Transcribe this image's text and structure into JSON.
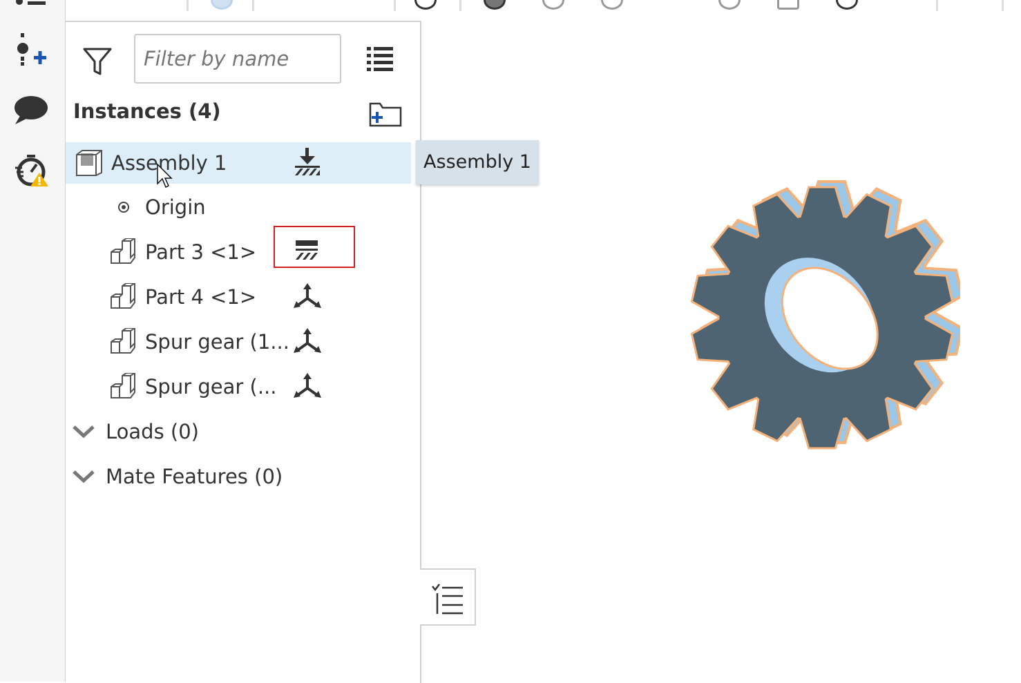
{
  "filter": {
    "placeholder": "Filter by name"
  },
  "instances": {
    "title": "Instances (4)",
    "items": [
      {
        "label": "Assembly 1",
        "icon": "assembly-icon",
        "state": "fixed-icon"
      },
      {
        "label": "Origin",
        "icon": "origin-icon"
      },
      {
        "label": "Part 3 <1>",
        "icon": "part-icon",
        "state": "grounded-icon"
      },
      {
        "label": "Part 4 <1>",
        "icon": "part-icon",
        "state": "free-dof-icon"
      },
      {
        "label": "Spur gear (1...",
        "icon": "part-icon",
        "state": "free-dof-icon"
      },
      {
        "label": "Spur gear (...",
        "icon": "part-icon",
        "state": "free-dof-icon"
      }
    ]
  },
  "loads": {
    "label": "Loads (0)"
  },
  "mates": {
    "label": "Mate Features (0)"
  },
  "tooltip": {
    "text": "Assembly 1"
  },
  "colors": {
    "selection": "#ddeef8",
    "highlight_box": "#d32020",
    "gear_fill": "#4f6473",
    "gear_edge": "#f4b27a",
    "accent": "#1a56b0"
  }
}
